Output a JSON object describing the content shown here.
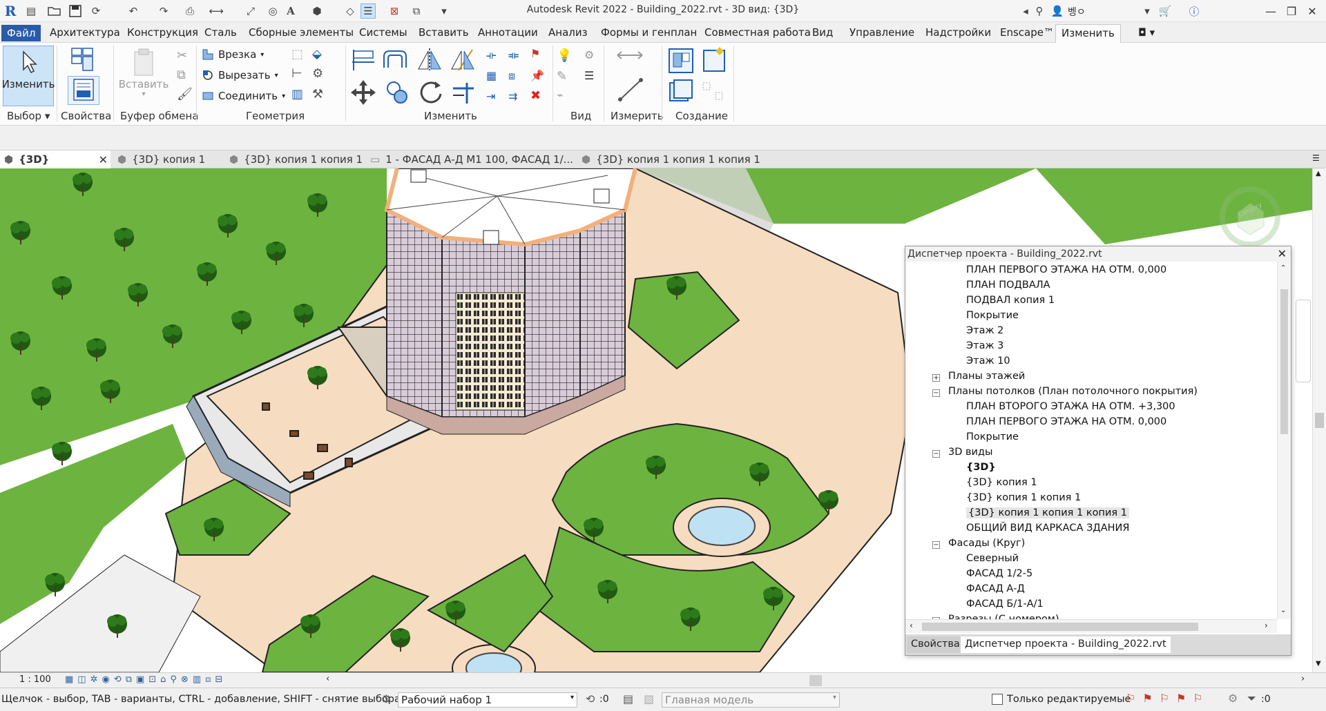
{
  "app": {
    "title": "Autodesk Revit 2022 - Building_2022.rvt - 3D вид: {3D}",
    "user": "벵ㅇ",
    "logo_letter": "R"
  },
  "ribbon_tabs": [
    "Файл",
    "Архитектура",
    "Конструкция",
    "Сталь",
    "Сборные элементы",
    "Системы",
    "Вставить",
    "Аннотации",
    "Анализ",
    "Формы и генплан",
    "Совместная работа",
    "Вид",
    "Управление",
    "Надстройки",
    "Enscape™",
    "Изменить"
  ],
  "ribbon": {
    "modify_label": "Изменить",
    "select_panel": "Выбор",
    "properties_panel": "Свойства",
    "paste_label": "Вставить",
    "clipboard_panel": "Буфер обмена",
    "cope": "Врезка",
    "cut": "Вырезать",
    "join": "Соединить",
    "geometry_panel": "Геометрия",
    "modify_panel": "Изменить",
    "view_panel": "Вид",
    "measure_panel": "Измерить",
    "create_panel": "Создание"
  },
  "view_tabs": [
    {
      "label": "{3D}",
      "active": true
    },
    {
      "label": "{3D} копия 1",
      "active": false
    },
    {
      "label": "{3D} копия 1 копия 1",
      "active": false
    },
    {
      "label": "1 - ФАСАД А-Д М1 100, ФАСАД 1/...",
      "active": false
    },
    {
      "label": "{3D} копия 1 копия 1 копия 1",
      "active": false
    }
  ],
  "viewcube_label": "Сверху",
  "project_browser": {
    "title": "Диспетчер проекта - Building_2022.rvt",
    "items": [
      {
        "label": "ПЛАН ПЕРВОГО ЭТАЖА НА ОТМ. 0,000",
        "level": 2
      },
      {
        "label": "ПЛАН ПОДВАЛА",
        "level": 2
      },
      {
        "label": "ПОДВАЛ копия 1",
        "level": 2
      },
      {
        "label": "Покрытие",
        "level": 2
      },
      {
        "label": "Этаж 2",
        "level": 2
      },
      {
        "label": "Этаж 3",
        "level": 2
      },
      {
        "label": "Этаж 10",
        "level": 2
      },
      {
        "label": "Планы этажей",
        "level": 1,
        "expander": "+"
      },
      {
        "label": "Планы потолков (План потолочного покрытия)",
        "level": 1,
        "expander": "−"
      },
      {
        "label": "ПЛАН ВТОРОГО ЭТАЖА НА ОТМ. +3,300",
        "level": 2
      },
      {
        "label": "ПЛАН ПЕРВОГО ЭТАЖА НА ОТМ. 0,000",
        "level": 2
      },
      {
        "label": "Покрытие",
        "level": 2
      },
      {
        "label": "3D виды",
        "level": 1,
        "expander": "−"
      },
      {
        "label": "{3D}",
        "level": 2,
        "bold": true
      },
      {
        "label": "{3D} копия 1",
        "level": 2
      },
      {
        "label": "{3D} копия 1 копия 1",
        "level": 2
      },
      {
        "label": "{3D} копия 1 копия 1 копия 1",
        "level": 2,
        "highlight": true
      },
      {
        "label": "ОБЩИЙ ВИД КАРКАСА ЗДАНИЯ",
        "level": 2
      },
      {
        "label": "Фасады (Круг)",
        "level": 1,
        "expander": "−"
      },
      {
        "label": "Северный",
        "level": 2
      },
      {
        "label": "ФАСАД 1/2-5",
        "level": 2
      },
      {
        "label": "ФАСАД А-Д",
        "level": 2
      },
      {
        "label": "ФАСАД Б/1-А/1",
        "level": 2
      },
      {
        "label": "Разрезы (С номером)",
        "level": 1,
        "expander": "−"
      }
    ],
    "tab_properties": "Свойства",
    "tab_browser": "Диспетчер проекта - Building_2022.rvt"
  },
  "view_control": {
    "scale": "1 : 100"
  },
  "status": {
    "hint": "Щелчок - выбор, TAB - варианты, CTRL - добавление, SHIFT - снятие выбора.",
    "workset": "Рабочий набор 1",
    "count": ":0",
    "design_option": "Главная модель",
    "editable_only": "Только редактируемые",
    "filter_count": ":0"
  },
  "colors": {
    "file_tab": "#2a5ba8",
    "grass": "#6db33f",
    "paving": "#f6dcc0",
    "facade": "#f7ead0",
    "roof": "#ffffff"
  }
}
